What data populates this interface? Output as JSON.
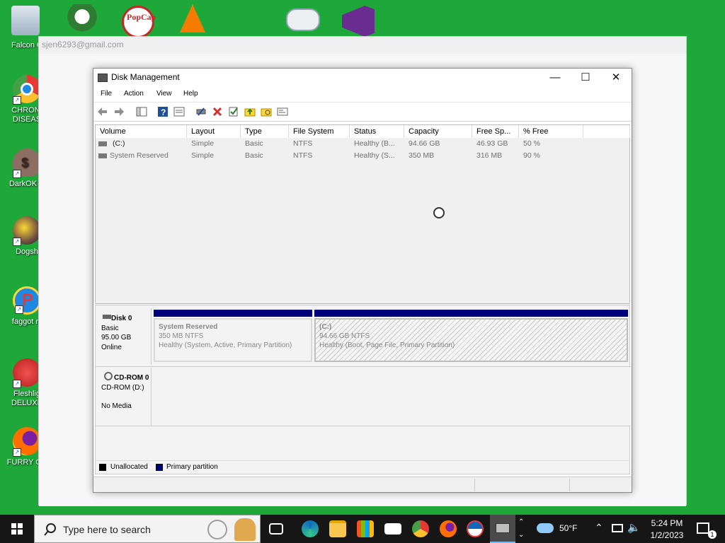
{
  "desktop": {
    "icons": [
      {
        "label": "Falcon C"
      },
      {
        "label": "CHRONI DISEAS"
      },
      {
        "label": "DarkOK H"
      },
      {
        "label": "Dogsh"
      },
      {
        "label": "faggot ni"
      },
      {
        "label": "Fleshlig DELUXE"
      },
      {
        "label": "FURRY CU"
      }
    ],
    "top_icons": [
      "recycle-bin-icon",
      "flower-icon",
      "popcap-icon",
      "vlc-icon",
      "gamepad-icon",
      "visual-studio-icon"
    ]
  },
  "background_window": {
    "email": "sjen6293@gmail.com"
  },
  "disk_management": {
    "title": "Disk Management",
    "menu": [
      "File",
      "Action",
      "View",
      "Help"
    ],
    "columns": [
      "Volume",
      "Layout",
      "Type",
      "File System",
      "Status",
      "Capacity",
      "Free Sp...",
      "% Free"
    ],
    "volumes": [
      {
        "volume": "(C:)",
        "layout": "Simple",
        "type": "Basic",
        "fs": "NTFS",
        "status": "Healthy (B...",
        "capacity": "94.66 GB",
        "free": "46.93 GB",
        "pct": "50 %"
      },
      {
        "volume": "System Reserved",
        "layout": "Simple",
        "type": "Basic",
        "fs": "NTFS",
        "status": "Healthy (S...",
        "capacity": "350 MB",
        "free": "316 MB",
        "pct": "90 %"
      }
    ],
    "disks": [
      {
        "name": "Disk 0",
        "type": "Basic",
        "size": "95.00 GB",
        "state": "Online"
      },
      {
        "name": "CD-ROM 0",
        "type": "CD-ROM (D:)",
        "size": "",
        "state": "No Media"
      }
    ],
    "partitions": [
      {
        "name": "System Reserved",
        "size": "350 MB NTFS",
        "status": "Healthy (System, Active, Primary Partition)"
      },
      {
        "name": "(C:)",
        "size": "94.66 GB NTFS",
        "status": "Healthy (Boot, Page File, Primary Partition)"
      }
    ],
    "legend": {
      "unallocated": "Unallocated",
      "primary": "Primary partition"
    },
    "colors": {
      "primary": "#00007a",
      "unallocated": "#000000"
    }
  },
  "taskbar": {
    "search_placeholder": "Type here to search",
    "weather": "50°F",
    "time": "5:24 PM",
    "date": "1/2/2023",
    "notification_count": "1"
  }
}
